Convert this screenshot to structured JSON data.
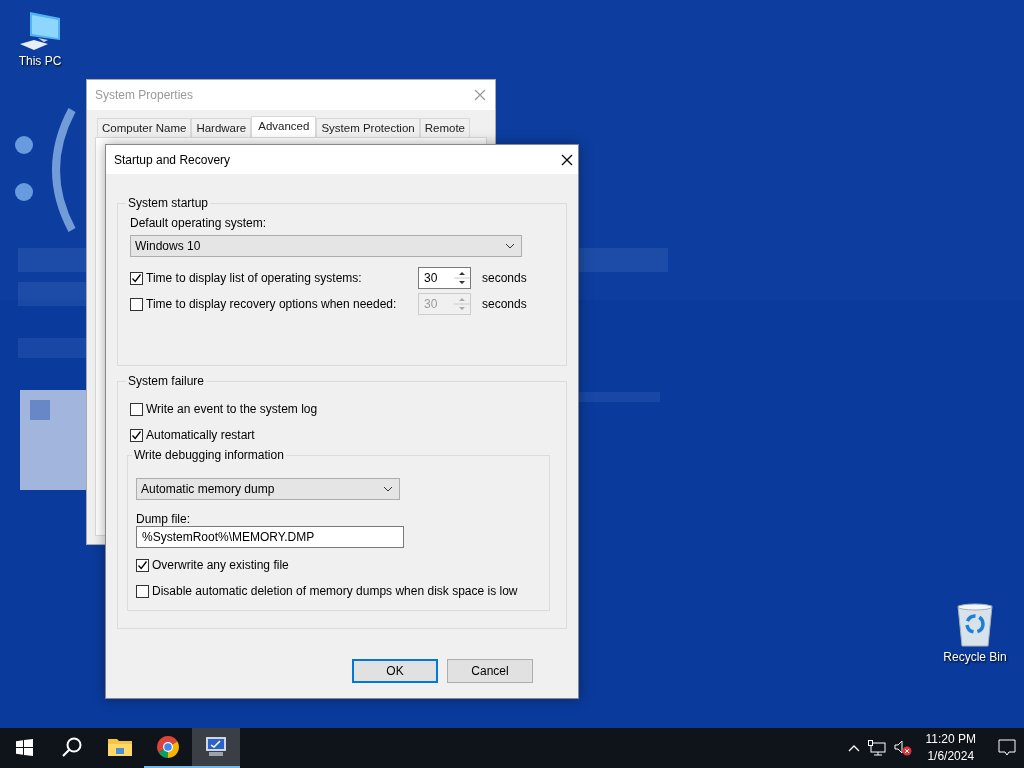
{
  "desktop_icons": [
    {
      "kind": "pc",
      "label": "This PC"
    },
    {
      "kind": "bin",
      "label": "Recycle Bin"
    }
  ],
  "background_window": {
    "title": "System Properties",
    "tabs": [
      {
        "label": "Computer Name",
        "selected": false
      },
      {
        "label": "Hardware",
        "selected": false
      },
      {
        "label": "Advanced",
        "selected": true
      },
      {
        "label": "System Protection",
        "selected": false
      },
      {
        "label": "Remote",
        "selected": false
      }
    ]
  },
  "dialog": {
    "title": "Startup and Recovery",
    "startup": {
      "legend": "System startup",
      "default_os_label": "Default operating system:",
      "default_os": "Windows 10",
      "options": [
        {
          "label": "Time to display list of operating systems:",
          "checked": true,
          "value": "30",
          "unit": "seconds",
          "disabled": false
        },
        {
          "label": "Time to display recovery options when needed:",
          "checked": false,
          "value": "30",
          "unit": "seconds",
          "disabled": true
        }
      ]
    },
    "failure": {
      "legend": "System failure",
      "options": [
        {
          "label": "Write an event to the system log",
          "checked": false
        },
        {
          "label": "Automatically restart",
          "checked": true
        }
      ],
      "debug": {
        "legend": "Write debugging information",
        "dump_type": "Automatic memory dump",
        "dump_file_label": "Dump file:",
        "dump_file": "%SystemRoot%\\MEMORY.DMP",
        "options": [
          {
            "label": "Overwrite any existing file",
            "checked": true
          },
          {
            "label": "Disable automatic deletion of memory dumps when disk space is low",
            "checked": false
          }
        ]
      }
    },
    "buttons": [
      {
        "label": "OK",
        "default": true
      },
      {
        "label": "Cancel",
        "default": false
      }
    ]
  },
  "taskbar": {
    "apps": [
      {
        "kind": "start",
        "running": false,
        "active": false
      },
      {
        "kind": "search",
        "running": false,
        "active": false
      },
      {
        "kind": "explorer",
        "running": false,
        "active": false
      },
      {
        "kind": "chrome",
        "running": true,
        "active": false
      },
      {
        "kind": "sysprops",
        "running": true,
        "active": true
      }
    ],
    "time": "11:20 PM",
    "date": "1/6/2024"
  }
}
